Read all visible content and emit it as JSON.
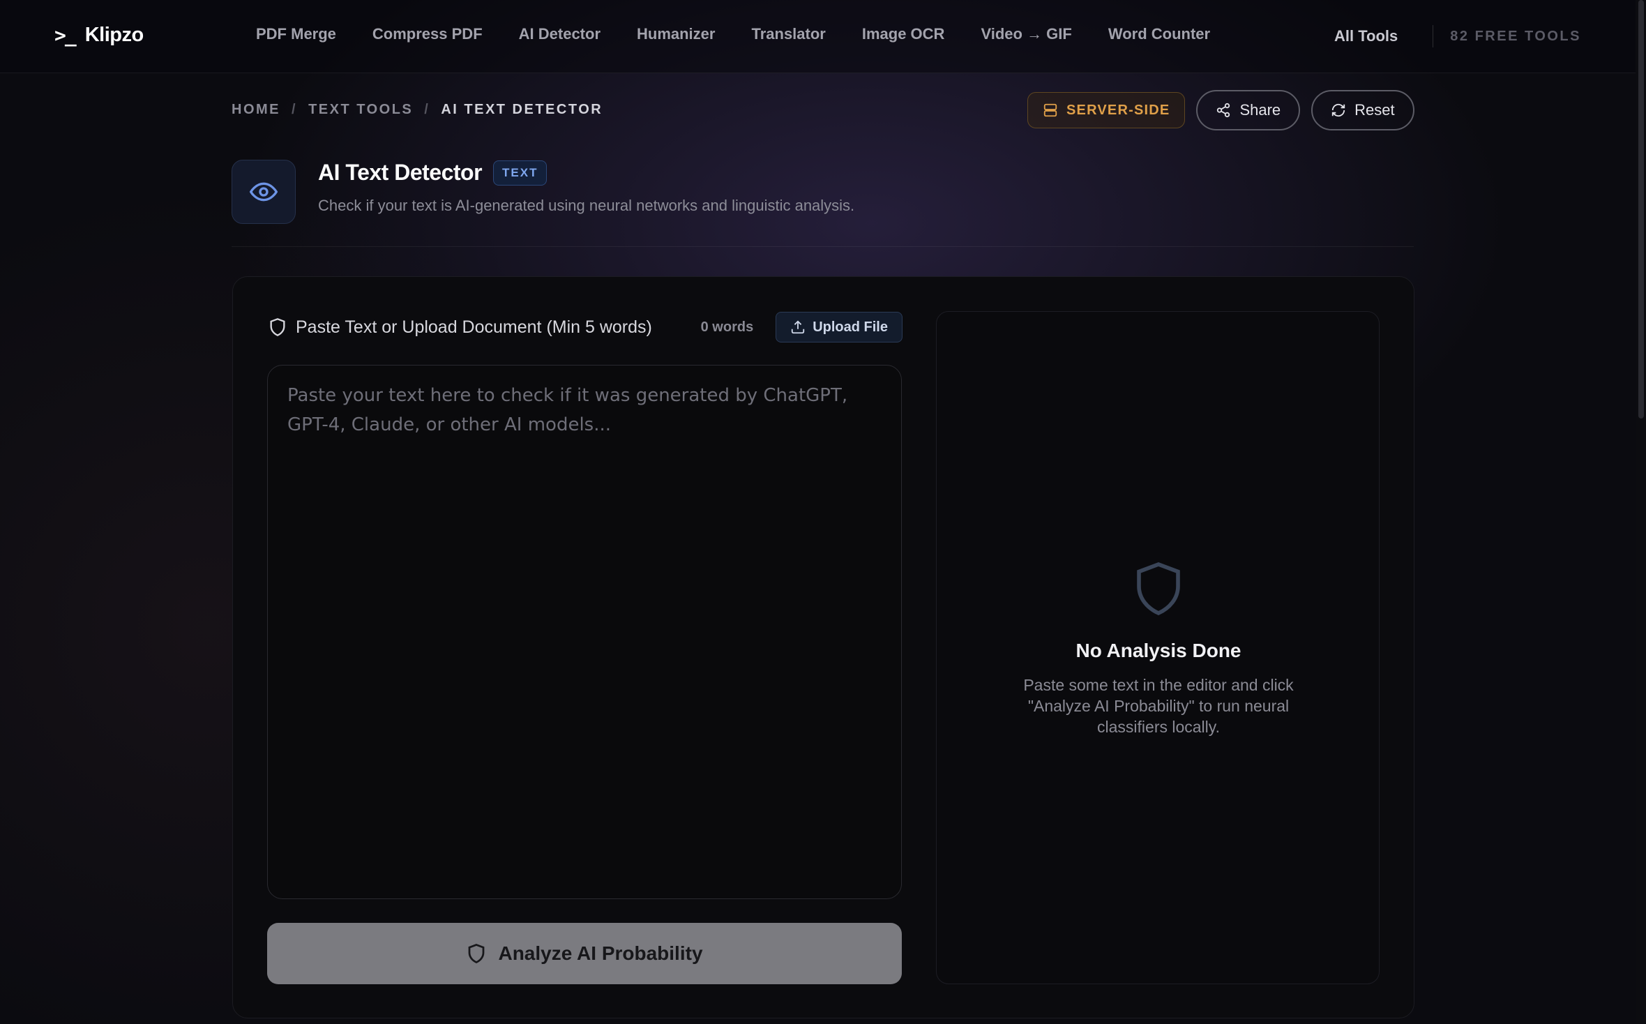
{
  "nav": {
    "logo_mark": ">_",
    "logo_text": "Klipzo",
    "links": [
      "PDF Merge",
      "Compress PDF",
      "AI Detector",
      "Humanizer",
      "Translator",
      "Image OCR",
      "Video → GIF",
      "Word Counter"
    ],
    "all_tools": "All Tools",
    "free_tools": "82 FREE TOOLS"
  },
  "breadcrumb": {
    "items": [
      "HOME",
      "TEXT TOOLS",
      "AI TEXT DETECTOR"
    ],
    "separator": "/"
  },
  "actions": {
    "server_badge": "SERVER-SIDE",
    "share": "Share",
    "reset": "Reset"
  },
  "header": {
    "title": "AI Text Detector",
    "tag": "TEXT",
    "subtitle": "Check if your text is AI-generated using neural networks and linguistic analysis."
  },
  "editor": {
    "title": "Paste Text or Upload Document (Min 5 words)",
    "word_count": "0 words",
    "upload_label": "Upload File",
    "value": "",
    "placeholder": "Paste your text here to check if it was generated by ChatGPT, GPT-4, Claude, or other AI models...",
    "analyze_label": "Analyze AI Probability"
  },
  "result": {
    "empty_title": "No Analysis Done",
    "empty_text": "Paste some text in the editor and click \"Analyze AI Probability\" to run neural classifiers locally."
  },
  "icons": {
    "logo": "terminal-prompt-icon",
    "server": "server-icon",
    "share": "share-icon",
    "reset": "refresh-icon",
    "tool": "eye-icon",
    "editor": "shield-icon",
    "upload": "upload-icon",
    "analyze": "shield-icon",
    "empty": "shield-icon"
  },
  "colors": {
    "accent_blue": "#7fa7ef",
    "server_badge": "#e0a049",
    "analyze_button": "#7b7b80",
    "background": "#0b0b10"
  }
}
